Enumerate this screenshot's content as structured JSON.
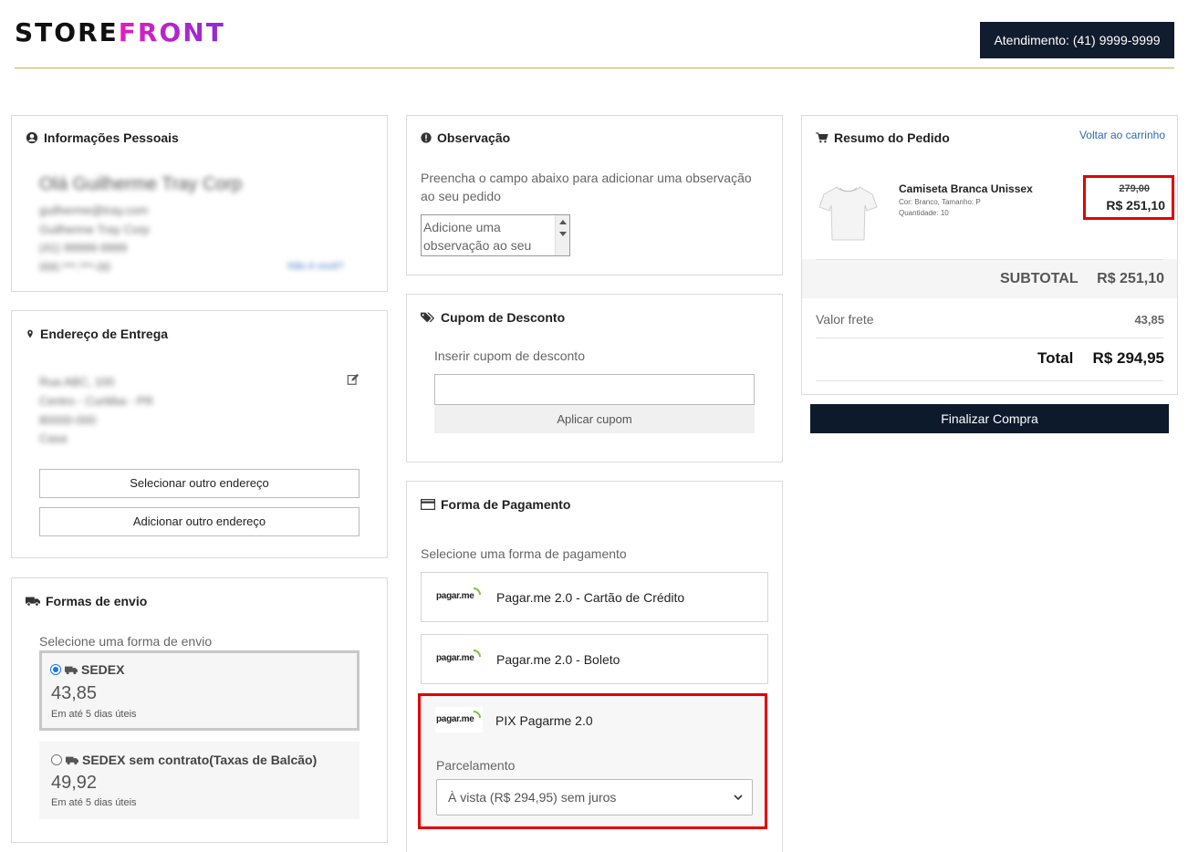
{
  "header": {
    "logo_part1": "STORE",
    "logo_part2": "FRONT",
    "atendimento": "Atendimento: (41) 9999-9999"
  },
  "personal": {
    "title": "Informações Pessoais",
    "name": "Olá Guilherme Tray Corp",
    "email": "guilherme@tray.com",
    "company": "Guilherme Tray Corp",
    "phone": "(41) 99999-9999",
    "doc": "000.***.***-00",
    "link": "Não é você?"
  },
  "address": {
    "title": "Endereço de Entrega",
    "line1": "Rua ABC, 100",
    "line2": "Centro - Curitiba - PR",
    "line3": "80000-000",
    "line4": "Casa",
    "btn_select": "Selecionar outro endereço",
    "btn_add": "Adicionar outro endereço"
  },
  "shipping": {
    "title": "Formas de envio",
    "prompt": "Selecione uma forma de envio",
    "options": [
      {
        "name": "SEDEX",
        "price": "43,85",
        "days": "Em até 5 dias úteis"
      },
      {
        "name": "SEDEX sem contrato(Taxas de Balcão)",
        "price": "49,92",
        "days": "Em até 5 dias úteis"
      }
    ]
  },
  "observation": {
    "title": "Observação",
    "text": "Preencha o campo abaixo para adicionar uma observação ao seu pedido",
    "placeholder": "Adicione uma observação ao seu pedido"
  },
  "coupon": {
    "title": "Cupom de Desconto",
    "label": "Inserir cupom de desconto",
    "button": "Aplicar cupom"
  },
  "payment": {
    "title": "Forma de Pagamento",
    "prompt": "Selecione uma forma de pagamento",
    "logo": "pagar.me",
    "options": [
      {
        "label": "Pagar.me 2.0 - Cartão de Crédito"
      },
      {
        "label": "Pagar.me 2.0 - Boleto"
      },
      {
        "label": "PIX Pagarme 2.0"
      }
    ],
    "installments_label": "Parcelamento",
    "installments_value": "À vista (R$ 294,95) sem juros"
  },
  "summary": {
    "title": "Resumo do Pedido",
    "back_link": "Voltar ao carrinho",
    "product_name": "Camiseta Branca Unissex",
    "product_attrs": "Cor: Branco, Tamanho: P",
    "product_qty": "Quantidade: 10",
    "old_price": "279,00",
    "price": "R$ 251,10",
    "subtotal_label": "SUBTOTAL",
    "subtotal_value": "R$ 251,10",
    "freight_label": "Valor frete",
    "freight_value": "43,85",
    "total_label": "Total",
    "total_value": "R$ 294,95",
    "finalize": "Finalizar Compra"
  }
}
